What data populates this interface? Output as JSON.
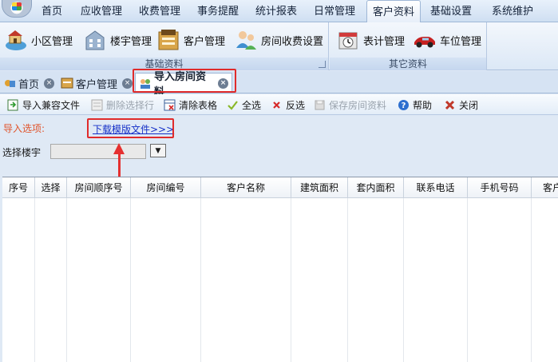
{
  "menu": {
    "items": [
      "首页",
      "应收管理",
      "收费管理",
      "事务提醒",
      "统计报表",
      "日常管理",
      "客户资料",
      "基础设置",
      "系统维护"
    ],
    "active_index": 6
  },
  "ribbon": {
    "groups": [
      {
        "label": "基础资料",
        "buttons": [
          "小区管理",
          "楼宇管理",
          "客户管理",
          "房间收费设置"
        ]
      },
      {
        "label": "其它资料",
        "buttons": [
          "表计管理",
          "车位管理"
        ]
      }
    ]
  },
  "doc_tabs": [
    {
      "label": "首页",
      "close": "×"
    },
    {
      "label": "客户管理",
      "close": "×"
    },
    {
      "label": "导入房间资料",
      "close": "×",
      "active": true
    }
  ],
  "toolbar": {
    "buttons": [
      {
        "label": "导入兼容文件",
        "icon": "import-icon",
        "enabled": true
      },
      {
        "label": "删除选择行",
        "icon": "delete-rows-icon",
        "enabled": false
      },
      {
        "label": "清除表格",
        "icon": "clear-table-icon",
        "enabled": true
      },
      {
        "label": "全选",
        "icon": "check-icon",
        "enabled": true
      },
      {
        "label": "反选",
        "icon": "cross-icon",
        "enabled": true
      },
      {
        "label": "保存房间资料",
        "icon": "save-icon",
        "enabled": false
      },
      {
        "label": "帮助",
        "icon": "help-icon",
        "enabled": true
      },
      {
        "label": "关闭",
        "icon": "close-icon",
        "enabled": true
      }
    ]
  },
  "form": {
    "import_options_label": "导入选项:",
    "download_template_link": "下载模版文件>>>",
    "select_building_label": "选择楼宇",
    "select_building_value": "",
    "combo_arrow": "▼"
  },
  "grid": {
    "columns": [
      "序号",
      "选择",
      "房间顺序号",
      "房间编号",
      "客户名称",
      "建筑面积",
      "套内面积",
      "联系电话",
      "手机号码",
      "客户"
    ],
    "rows": []
  },
  "colors": {
    "highlight": "#e02b2b",
    "link": "#1530c8",
    "import_label": "#e0542b"
  }
}
